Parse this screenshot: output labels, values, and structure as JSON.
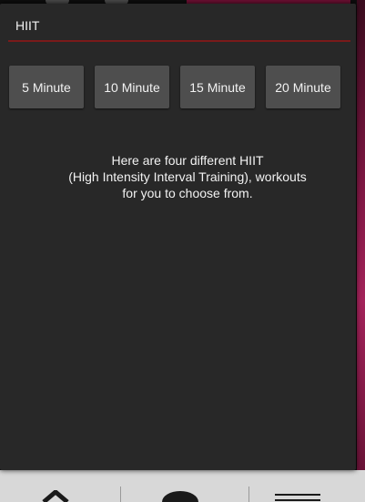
{
  "dialog": {
    "title": "HIIT",
    "buttons": [
      {
        "label": "5 Minute"
      },
      {
        "label": "10 Minute"
      },
      {
        "label": "15 Minute"
      },
      {
        "label": "20 Minute"
      }
    ],
    "description_lines": [
      "Here are four different HIIT",
      "(High Intensity Interval Training), workouts",
      "for you to choose from."
    ]
  },
  "colors": {
    "dialog_background": "#282828",
    "title_divider": "#7a1a1a",
    "button_background": "#4e4e4e",
    "text": "#f2f2f2"
  },
  "bottom_nav": {
    "icons": [
      "home-icon",
      "profile-icon",
      "menu-icon"
    ]
  }
}
